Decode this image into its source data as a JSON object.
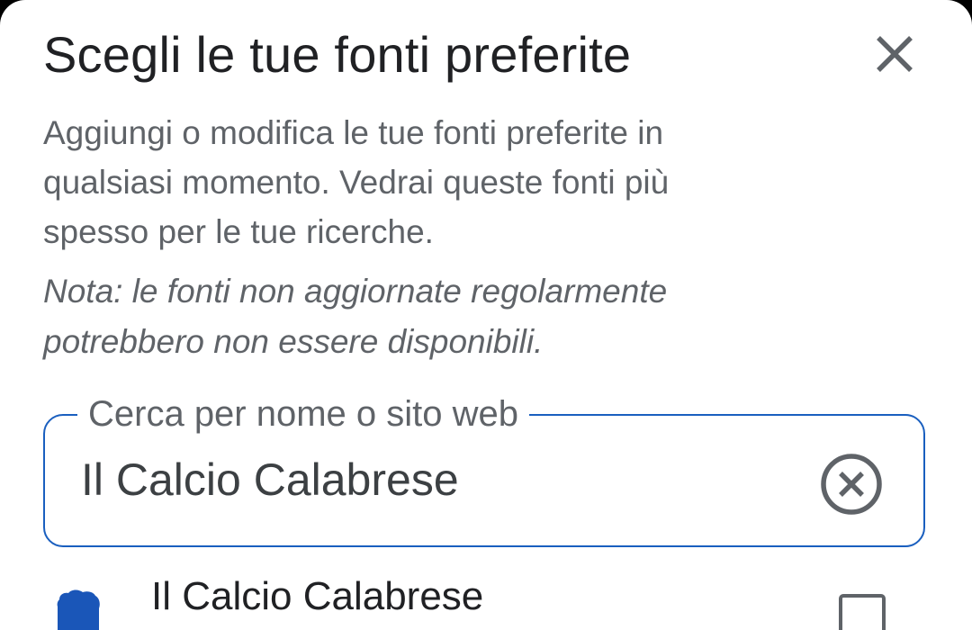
{
  "dialog": {
    "title": "Scegli le tue fonti preferite",
    "close_icon": "close-icon",
    "description": "Aggiungi o modifica le tue fonti preferite in qualsiasi momento. Vedrai queste fonti più spesso per le tue ricerche.",
    "note": "Nota: le fonti non aggiornate regolarmente potrebbero non essere disponibili."
  },
  "search": {
    "label": "Cerca per nome o sito web",
    "value": "Il Calcio Calabrese",
    "clear_icon": "clear-circle-icon"
  },
  "results": [
    {
      "name": "Il Calcio Calabrese",
      "logo_icon": "source-logo-icon",
      "checked": false
    }
  ],
  "colors": {
    "accent": "#1a5fbf",
    "text_primary": "#202124",
    "text_secondary": "#5f6368",
    "logo": "#1a56b8"
  }
}
